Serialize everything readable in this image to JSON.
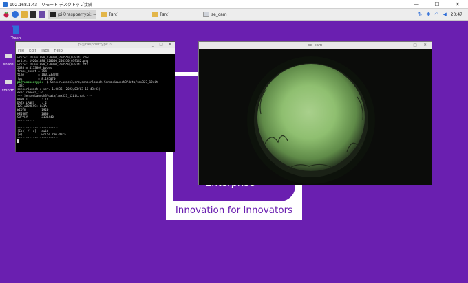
{
  "rdp": {
    "title": "192.168.1.43 - リモート デスクトップ接続",
    "minimize": "—",
    "maximize": "☐",
    "close": "✕"
  },
  "panel": {
    "tasks": [
      {
        "label": "pi@raspberrypi: ~"
      },
      {
        "label": "[src]"
      },
      {
        "label": "[src]"
      },
      {
        "label": "se_cam"
      }
    ],
    "clock": "20:47"
  },
  "desktop": {
    "icons": [
      {
        "label": "Trash"
      },
      {
        "label": "share"
      },
      {
        "label": "thindb"
      }
    ]
  },
  "logo": {
    "wordmark": "Enterprise",
    "tagline": "Innovation for Innovators"
  },
  "terminal": {
    "title": "pi@raspberrypi: ~",
    "menu": [
      "File",
      "Edit",
      "Tabs",
      "Help"
    ],
    "lines": [
      "write: 1920x1080_220000_204550_039142.raw",
      "write: 1920x1080_220000_204550_039142.png",
      "write: 1920x1080_220000_204550_039142.fts",
      "2688 = 4173809 bytes",
      "frame_count = 754",
      "time        = 100.233208",
      "fps         = 8.195070",
      "pi@raspberrypi:~ $ SensorLaunch3/src/sensorlaunch SensorLaunch3/data/imx327_12bit",
      ".dat",
      "sensorlaunch.c ver. 1.0036 (2022/03/03 16:43:03)",
      "exec camera_i2c",
      "--- SensorLaunch3/data/imx327_12bit.dat ---",
      "RAWBIT        : 12",
      "DATA_LANES    : 2",
      "I2C_ADDRESS: 0x1A",
      "WIDTH       : 1920",
      "HEIGHT      : 1080",
      "SUPPLY      : 3133440",
      "----------",
      "",
      "------------------------",
      "[Esc] / [q] : quit",
      "[w]         : write raw data",
      "------------------------",
      "█"
    ]
  },
  "camera": {
    "title": "se_cam"
  }
}
